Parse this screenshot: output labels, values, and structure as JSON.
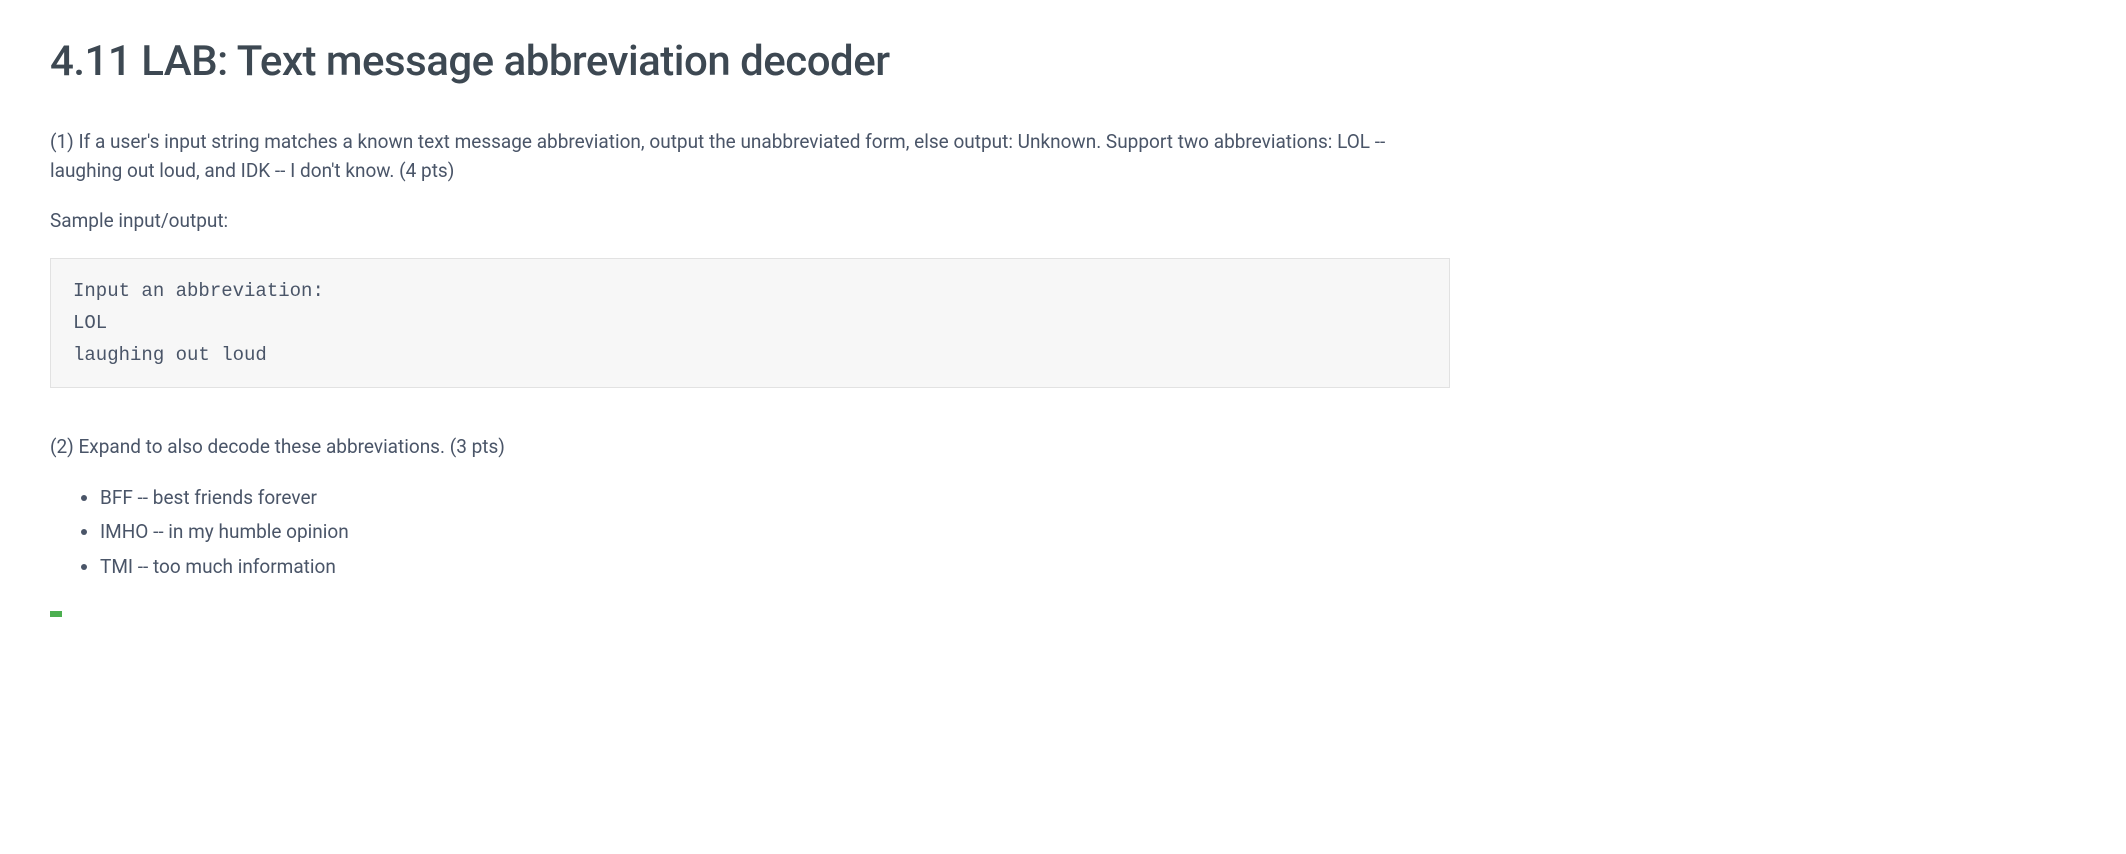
{
  "title": "4.11 LAB: Text message abbreviation decoder",
  "para1": "(1) If a user's input string matches a known text message abbreviation, output the unabbreviated form, else output: Unknown. Support two abbreviations: LOL -- laughing out loud, and IDK -- I don't know. (4 pts)",
  "sampleLabel": "Sample input/output:",
  "codeBlock": "Input an abbreviation:\nLOL\nlaughing out loud",
  "para2": "(2) Expand to also decode these abbreviations. (3 pts)",
  "items": [
    "BFF -- best friends forever",
    "IMHO -- in my humble opinion",
    "TMI -- too much information"
  ]
}
